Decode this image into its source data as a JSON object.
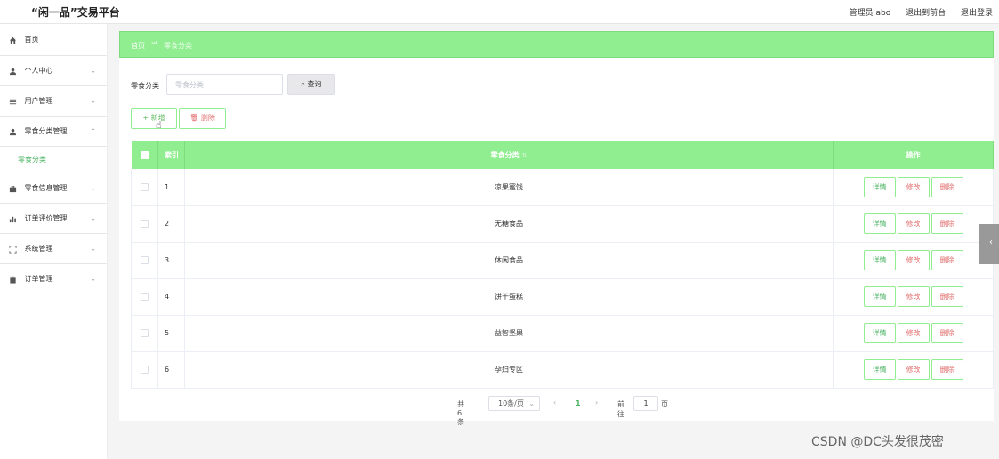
{
  "header": {
    "title": "“闲一品”交易平台",
    "user_label": "管理员 abo",
    "to_front": "退出到前台",
    "logout": "退出登录"
  },
  "sidebar": {
    "items": [
      {
        "label": "首页",
        "icon": "home-icon"
      },
      {
        "label": "个人中心",
        "icon": "user-icon"
      },
      {
        "label": "用户管理",
        "icon": "list-icon"
      },
      {
        "label": "零食分类管理",
        "icon": "user-icon"
      },
      {
        "label": "零食信息管理",
        "icon": "briefcase-icon"
      },
      {
        "label": "订单评价管理",
        "icon": "bar-chart-icon"
      },
      {
        "label": "系统管理",
        "icon": "fullscreen-icon"
      },
      {
        "label": "订单管理",
        "icon": "clipboard-icon"
      }
    ],
    "active_sub": "零食分类"
  },
  "breadcrumb": {
    "home": "首页",
    "current": "零食分类"
  },
  "search": {
    "label": "零食分类",
    "placeholder": "零食分类",
    "button": "查询"
  },
  "actions": {
    "add": "新增",
    "delete": "删除"
  },
  "table": {
    "headers": {
      "index": "索引",
      "name": "零食分类",
      "ops": "操作"
    },
    "rows": [
      {
        "index": "1",
        "name": "凉果蜜饯"
      },
      {
        "index": "2",
        "name": "无糖食品"
      },
      {
        "index": "3",
        "name": "休闲食品"
      },
      {
        "index": "4",
        "name": "饼干蛋糕"
      },
      {
        "index": "5",
        "name": "益智坚果"
      },
      {
        "index": "6",
        "name": "孕妇专区"
      }
    ],
    "op_labels": {
      "detail": "详情",
      "edit": "修改",
      "delete": "删除"
    }
  },
  "pagination": {
    "total": "共 6 条",
    "page_size": "10条/页",
    "current_page": "1",
    "goto_label": "前往",
    "goto_value": "1",
    "page_suffix": "页"
  },
  "colors": {
    "accent": "#90ee90",
    "link": "#4ab363",
    "danger": "#e26d6d"
  },
  "watermark": "CSDN @DC头发很茂密"
}
